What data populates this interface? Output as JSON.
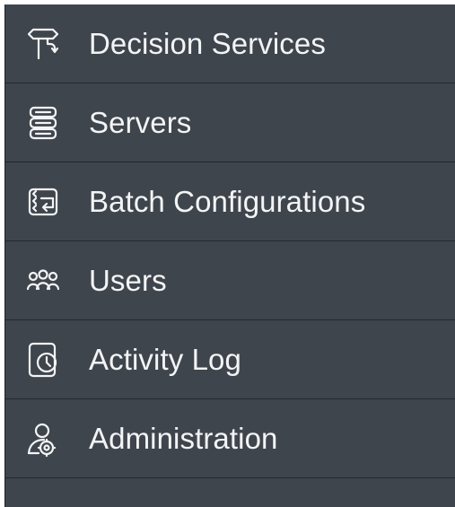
{
  "sidebar": {
    "items": [
      {
        "label": "Decision Services",
        "icon": "decision-services-icon"
      },
      {
        "label": "Servers",
        "icon": "server-stack-icon"
      },
      {
        "label": "Batch Configurations",
        "icon": "batch-configurations-icon"
      },
      {
        "label": "Users",
        "icon": "users-icon"
      },
      {
        "label": "Activity Log",
        "icon": "activity-log-icon"
      },
      {
        "label": "Administration",
        "icon": "administration-icon"
      }
    ]
  }
}
